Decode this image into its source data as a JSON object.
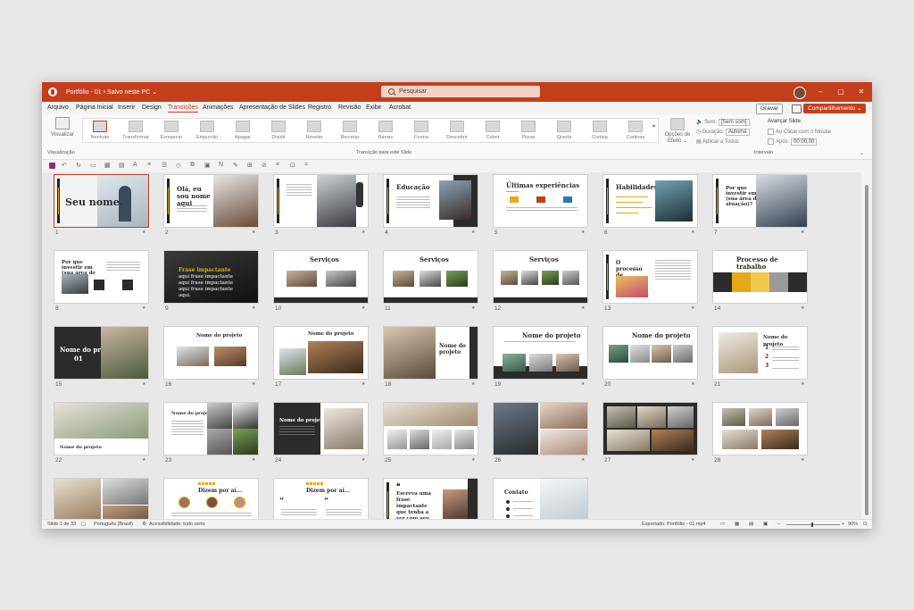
{
  "titlebar": {
    "doc_title": "Portfólio - 01 • Salvo neste PC ⌄",
    "search_placeholder": "Pesquisar",
    "minimize": "–",
    "maximize": "▢",
    "close": "✕"
  },
  "menu": {
    "items": [
      "Arquivo",
      "Página Inicial",
      "Inserir",
      "Design",
      "Transições",
      "Animações",
      "Apresentação de Slides",
      "Registro",
      "Revisão",
      "Exibir",
      "Acrobat"
    ],
    "active": "Transições",
    "gravar": "Gravar",
    "share": "Compartilhamento ⌄"
  },
  "ribbon": {
    "visualizar": "Visualizar",
    "visualizacao_group": "Visualização",
    "transitions": [
      "Nenhum",
      "Transformar",
      "Esmaecer",
      "Empurrão",
      "Apagar",
      "Dividir",
      "Revelar",
      "Recortar",
      "Barras",
      "Forma",
      "Descobrir",
      "Cobrir",
      "Piscar",
      "Queda",
      "Cortina",
      "Cortinas"
    ],
    "transition_group": "Transição para este Slide",
    "opcoes_efeito": "Opções de Efeito ⌄",
    "som_label": "Som:",
    "som_value": "[Sem som]",
    "duracao_label": "Duração:",
    "duracao_value": "Automá",
    "aplicar_todos": "Aplicar a Todos",
    "avancar_slide": "Avançar Slide",
    "ao_clicar": "Ao Clicar com o Mouse",
    "apos_label": "Após:",
    "apos_value": "00:00,00",
    "intervalo_group": "Intervalo"
  },
  "slides": [
    {
      "n": "1",
      "kind": "cover",
      "title": "Seu nome."
    },
    {
      "n": "2",
      "kind": "intro",
      "title": "Olá, eu sou nome aqui"
    },
    {
      "n": "3",
      "kind": "photo-right"
    },
    {
      "n": "4",
      "kind": "edu",
      "title": "Educação"
    },
    {
      "n": "5",
      "kind": "exp",
      "title": "Últimas experiências"
    },
    {
      "n": "6",
      "kind": "skills",
      "title": "Habilidades"
    },
    {
      "n": "7",
      "kind": "why",
      "title": "Por que investir em (sua área de atuação)?"
    },
    {
      "n": "8",
      "kind": "why2",
      "title": "Por que investir em (sua área de atuação)?"
    },
    {
      "n": "9",
      "kind": "quote-dark",
      "title": "Frase impactante",
      "subtitle": "aqui frase impactante aqui frase impactante aqui frase impactante aqui."
    },
    {
      "n": "10",
      "kind": "services",
      "title": "Serviços"
    },
    {
      "n": "11",
      "kind": "services",
      "title": "Serviços"
    },
    {
      "n": "12",
      "kind": "services4",
      "title": "Serviços"
    },
    {
      "n": "13",
      "kind": "process",
      "title": "O processo de trabalho"
    },
    {
      "n": "14",
      "kind": "process2",
      "title": "Processo de trabalho"
    },
    {
      "n": "15",
      "kind": "project-dark",
      "title": "Nome do projeto",
      "subtitle": "01"
    },
    {
      "n": "16",
      "kind": "project2",
      "title": "Nome do projeto"
    },
    {
      "n": "17",
      "kind": "project3",
      "title": "Nome do projeto"
    },
    {
      "n": "18",
      "kind": "project4",
      "title": "Nome do projeto"
    },
    {
      "n": "19",
      "kind": "project5",
      "title": "Nome do projeto"
    },
    {
      "n": "20",
      "kind": "project6",
      "title": "Nome do projeto"
    },
    {
      "n": "21",
      "kind": "project7",
      "title": "Nome do projeto"
    },
    {
      "n": "22",
      "kind": "project8",
      "title": "Nome do projeto"
    },
    {
      "n": "23",
      "kind": "project9",
      "title": "Nome do projeto"
    },
    {
      "n": "24",
      "kind": "project10",
      "title": "Nome do projeto"
    },
    {
      "n": "25",
      "kind": "gallery"
    },
    {
      "n": "26",
      "kind": "gallery2"
    },
    {
      "n": "27",
      "kind": "gallery-dark"
    },
    {
      "n": "28",
      "kind": "gallery3"
    },
    {
      "n": "",
      "kind": "gallery4"
    },
    {
      "n": "",
      "kind": "testimonial",
      "title": "Dizem por aí..."
    },
    {
      "n": "",
      "kind": "testimonial2",
      "title": "Dizem por aí..."
    },
    {
      "n": "",
      "kind": "quote2",
      "title": "Escreva uma frase impactante que tenha a ver com seu trabalho"
    },
    {
      "n": "",
      "kind": "contact",
      "title": "Contato"
    }
  ],
  "status": {
    "slide_count": "Slide 1 de 33",
    "language": "Português (Brasil)",
    "accessibility": "Acessibilidade: tudo certo",
    "export": "Exportado: Portfólio - 01.mp4",
    "zoom": "90%"
  },
  "colors": {
    "accent": "#c43e1c",
    "gold": "#e6a817",
    "dark": "#2b2b2b"
  }
}
